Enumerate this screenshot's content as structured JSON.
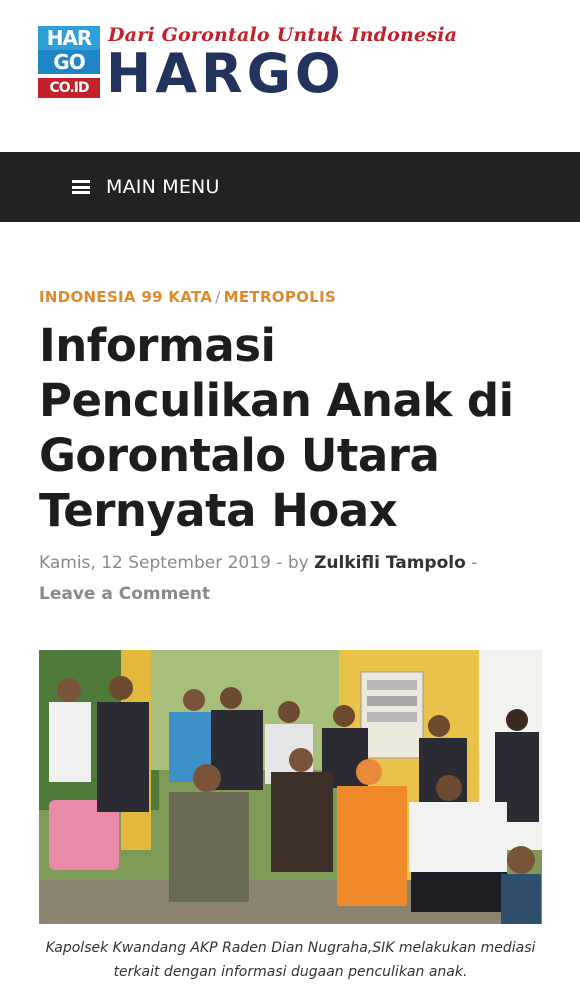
{
  "site": {
    "logo_cells": [
      "HAR",
      "GO",
      "CO.ID"
    ],
    "tagline": "Dari Gorontalo Untuk Indonesia",
    "wordmark": "HARGO"
  },
  "nav": {
    "label": "MAIN MENU"
  },
  "article": {
    "categories": [
      "INDONESIA 99 KATA",
      "METROPOLIS"
    ],
    "category_separator": "/",
    "title": "Informasi Penculikan Anak di Gorontalo Utara Ternyata Hoax",
    "date": "Kamis, 12 September 2019",
    "by_label": "by",
    "author": "Zulkifli Tampolo",
    "comment_link": "Leave a Comment",
    "caption": "Kapolsek Kwandang AKP Raden Dian Nugraha,SIK melakukan mediasi terkait dengan informasi dugaan penculikan anak."
  },
  "colors": {
    "accent": "#e0892b",
    "nav_bg": "#222222",
    "logo_navy": "#24325e",
    "logo_red": "#c4202a",
    "logo_blue": "#2e9fd8"
  }
}
